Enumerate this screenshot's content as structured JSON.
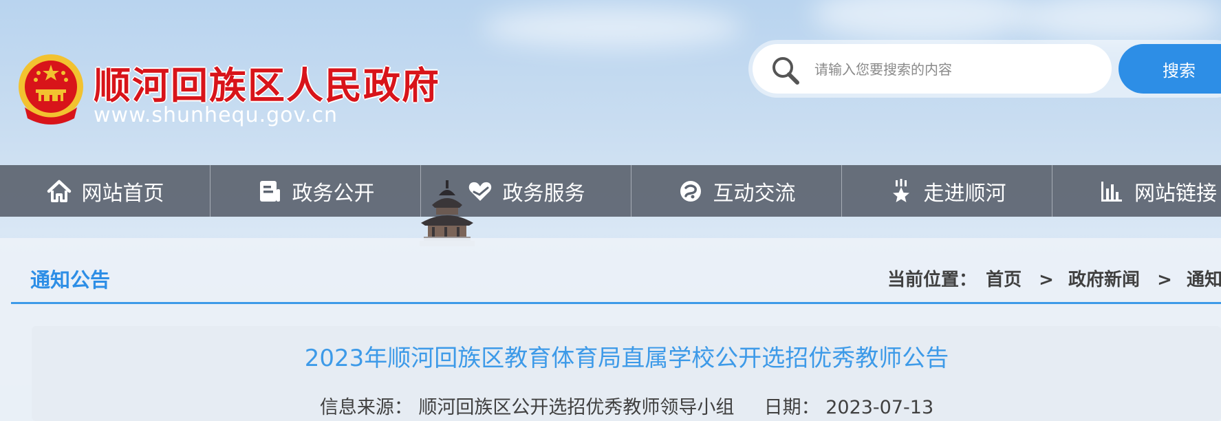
{
  "header": {
    "site_title": "顺河回族区人民政府",
    "site_url": "www.shunhequ.gov.cn",
    "emblem_icon": "national-emblem-icon"
  },
  "search": {
    "placeholder": "请输入您要搜索的内容",
    "value": "",
    "button_label": "搜索",
    "icon": "search-icon"
  },
  "nav": {
    "items": [
      {
        "label": "网站首页",
        "icon": "home-icon"
      },
      {
        "label": "政务公开",
        "icon": "document-icon"
      },
      {
        "label": "政务服务",
        "icon": "heart-hand-icon"
      },
      {
        "label": "互动交流",
        "icon": "chat-swirl-icon"
      },
      {
        "label": "走进顺河",
        "icon": "star-person-icon"
      },
      {
        "label": "网站链接",
        "icon": "bar-chart-icon"
      }
    ]
  },
  "section": {
    "title": "通知公告"
  },
  "breadcrumb": {
    "prefix": "当前位置：",
    "items": [
      "首页",
      "政府新闻",
      "通知公告"
    ],
    "separator": ">"
  },
  "article": {
    "title": "2023年顺河回族区教育体育局直属学校公开选招优秀教师公告",
    "source_label": "信息来源：",
    "source_value": "顺河回族区公开选招优秀教师领导小组",
    "date_label": "日期：",
    "date_value": "2023-07-13"
  },
  "colors": {
    "title_red": "#d8141a",
    "accent_blue": "#2d8ee6",
    "nav_bg": "#5c6470"
  }
}
